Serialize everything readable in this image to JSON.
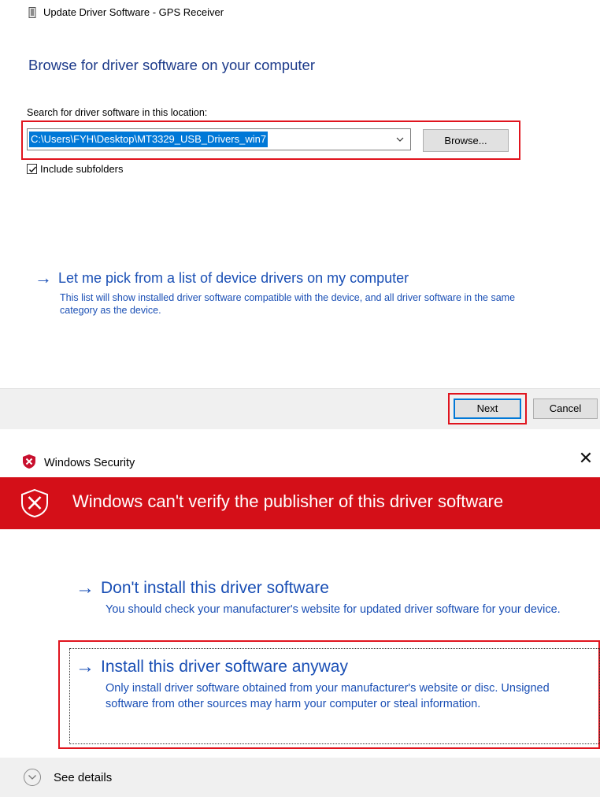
{
  "update_dialog": {
    "title": "Update Driver Software - GPS Receiver",
    "heading": "Browse for driver software on your computer",
    "search_label": "Search for driver software in this location:",
    "path_value": "C:\\Users\\FYH\\Desktop\\MT3329_USB_Drivers_win7",
    "browse_label": "Browse...",
    "include_subfolders_label": "Include subfolders",
    "include_subfolders_checked": true,
    "pick_link_title": "Let me pick from a list of device drivers on my computer",
    "pick_link_desc": "This list will show installed driver software compatible with the device, and all driver software in the same category as the device.",
    "next_label": "Next",
    "cancel_label": "Cancel"
  },
  "security_dialog": {
    "title": "Windows Security",
    "banner_text": "Windows can't verify the publisher of this driver software",
    "option1_title": "Don't install this driver software",
    "option1_desc": "You should check your manufacturer's website for updated driver software for your device.",
    "option2_title": "Install this driver software anyway",
    "option2_desc": "Only install driver software obtained from your manufacturer's website or disc. Unsigned software from other sources may harm your computer or steal information.",
    "see_details_label": "See details"
  },
  "colors": {
    "link_blue": "#1a4fb5",
    "heading_blue": "#1c3a8a",
    "banner_red": "#d40f18",
    "highlight_red": "#e0141e",
    "selection_blue": "#0078d7"
  },
  "icons": {
    "device": "device-icon",
    "shield": "shield-x-icon",
    "close": "close-icon",
    "arrow": "arrow-right-icon",
    "chevron": "chevron-down-icon"
  }
}
